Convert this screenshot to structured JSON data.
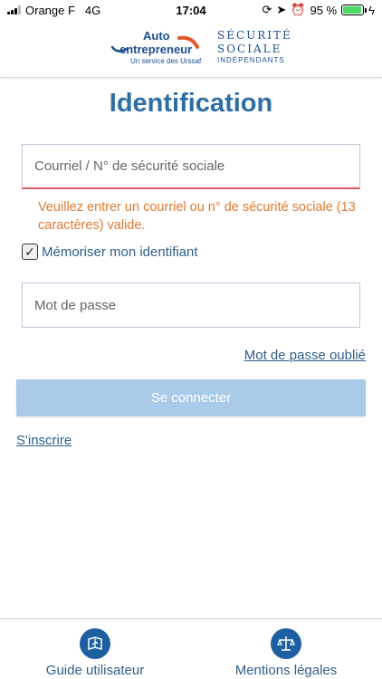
{
  "status_bar": {
    "carrier": "Orange F",
    "network": "4G",
    "time": "17:04",
    "battery": "95 %",
    "battery_level": 0.95
  },
  "header": {
    "logo_auto": "Auto",
    "logo_entrepreneur": "entrepreneur",
    "logo_service": "Un service des Urssaf",
    "logo_ss_line1": "SÉCURITÉ",
    "logo_ss_line2": "SOCIALE",
    "logo_ss_line3": "INDÉPENDANTS"
  },
  "form": {
    "title": "Identification",
    "id_placeholder": "Courriel / N° de sécurité sociale",
    "id_value": "",
    "error_message": "Veuillez entrer un courriel ou n° de sécurité sociale (13 caractères) valide.",
    "remember_label": "Mémoriser mon identifiant",
    "remember_checked": true,
    "password_placeholder": "Mot de passe",
    "password_value": "",
    "forgot_password": "Mot de passe oublié",
    "connect_label": "Se connecter",
    "signup_label": "S'inscrire"
  },
  "footer": {
    "items": [
      {
        "label": "Guide utilisateur",
        "icon": "guide-icon"
      },
      {
        "label": "Mentions légales",
        "icon": "scales-icon"
      }
    ]
  },
  "colors": {
    "title": "#2e6ea6",
    "error": "#e07a2e",
    "button_disabled": "#a9cae8",
    "accent": "#1d5fa0"
  }
}
